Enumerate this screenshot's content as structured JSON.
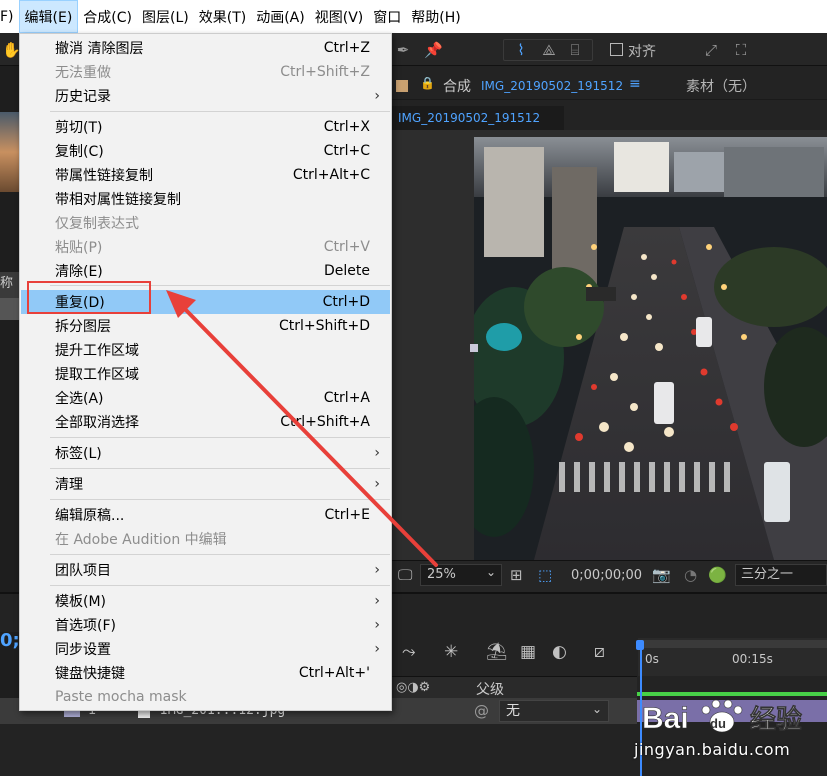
{
  "menubar": {
    "items": [
      {
        "label": "F)"
      },
      {
        "label": "编辑(E)"
      },
      {
        "label": "合成(C)"
      },
      {
        "label": "图层(L)"
      },
      {
        "label": "效果(T)"
      },
      {
        "label": "动画(A)"
      },
      {
        "label": "视图(V)"
      },
      {
        "label": "窗口"
      },
      {
        "label": "帮助(H)"
      }
    ]
  },
  "edit_menu": {
    "items": [
      {
        "label": "撤消 清除图层",
        "shortcut": "Ctrl+Z"
      },
      {
        "label": "无法重做",
        "shortcut": "Ctrl+Shift+Z",
        "disabled": true
      },
      {
        "label": "历史记录",
        "submenu": true
      },
      {
        "label": "剪切(T)",
        "shortcut": "Ctrl+X"
      },
      {
        "label": "复制(C)",
        "shortcut": "Ctrl+C"
      },
      {
        "label": "带属性链接复制",
        "shortcut": "Ctrl+Alt+C"
      },
      {
        "label": "带相对属性链接复制"
      },
      {
        "label": "仅复制表达式",
        "disabled": true
      },
      {
        "label": "粘贴(P)",
        "shortcut": "Ctrl+V",
        "disabled": true
      },
      {
        "label": "清除(E)",
        "shortcut": "Delete"
      },
      {
        "label": "重复(D)",
        "shortcut": "Ctrl+D",
        "highlighted": true
      },
      {
        "label": "拆分图层",
        "shortcut": "Ctrl+Shift+D"
      },
      {
        "label": "提升工作区域"
      },
      {
        "label": "提取工作区域"
      },
      {
        "label": "全选(A)",
        "shortcut": "Ctrl+A"
      },
      {
        "label": "全部取消选择",
        "shortcut": "Ctrl+Shift+A"
      },
      {
        "label": "标签(L)",
        "submenu": true
      },
      {
        "label": "清理",
        "submenu": true
      },
      {
        "label": "编辑原稿...",
        "shortcut": "Ctrl+E"
      },
      {
        "label": "在 Adobe Audition 中编辑",
        "disabled": true
      },
      {
        "label": "团队项目",
        "submenu": true
      },
      {
        "label": "模板(M)",
        "submenu": true
      },
      {
        "label": "首选项(F)",
        "submenu": true
      },
      {
        "label": "同步设置",
        "submenu": true
      },
      {
        "label": "键盘快捷键",
        "shortcut": "Ctrl+Alt+'"
      },
      {
        "label": "Paste mocha mask",
        "disabled": true
      }
    ]
  },
  "toolbar": {
    "align_label": "对齐"
  },
  "composition": {
    "tab_label": "合成",
    "tab_name": "IMG_20190502_191512",
    "tab_menu": "≡",
    "subtab_name": "IMG_20190502_191512",
    "footage_label": "素材（无）"
  },
  "viewer": {
    "zoom": "25%",
    "timecode": "0;00;00;00",
    "guides": "三分之一"
  },
  "timeline": {
    "left_timecode": "0;",
    "ruler_start": "0s",
    "ruler_mark": "00:15s",
    "parent_column": "父级",
    "parent_value": "无",
    "layer_number": "1",
    "layer_name": "IMG_201...12.jpg"
  },
  "left_panel": {
    "label": "称"
  },
  "watermark": {
    "logo_text": "Baidu经验",
    "url": "jingyan.baidu.com"
  },
  "colors": {
    "highlight": "#91c9f7",
    "annotation": "#e8403a",
    "accent_blue": "#4fa3ff"
  }
}
